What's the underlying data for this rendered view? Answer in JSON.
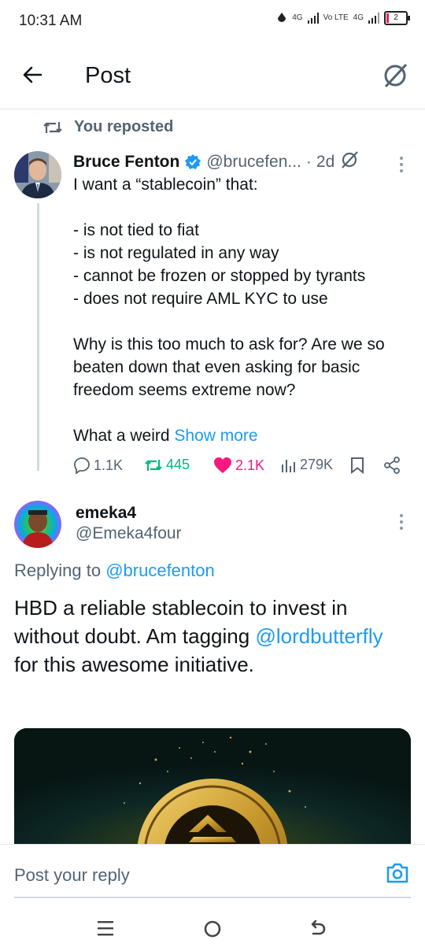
{
  "status_bar": {
    "time": "10:31 AM",
    "signal1": "4G",
    "signal2": "Vo LTE",
    "signal3": "4G",
    "battery": "2"
  },
  "header": {
    "title": "Post"
  },
  "repost_notice": "You reposted",
  "tweet": {
    "author_name": "Bruce Fenton",
    "author_handle": "@brucefen...",
    "time_sep": "·",
    "age": "2d",
    "lines": [
      "I want a “stablecoin” that:",
      "",
      "- is not tied to fiat",
      "- is not regulated in any way",
      "- cannot be frozen or stopped by tyrants",
      "- does not require AML KYC to use",
      "",
      "Why is this too much to ask for?  Are we so beaten down that even asking for basic freedom seems extreme now?",
      "",
      "What a weird"
    ],
    "show_more": "Show more",
    "stats": {
      "replies": "1.1K",
      "reposts": "445",
      "likes": "2.1K",
      "views": "279K"
    }
  },
  "reply": {
    "author_name": "emeka4",
    "author_handle": "@Emeka4four",
    "replying_prefix": "Replying to",
    "replying_to": "@brucefenton",
    "text_before": "HBD a reliable stablecoin to invest in without doubt. Am tagging",
    "mention": "@lordbutterfly",
    "text_after": "for this awesome initiative."
  },
  "composer": {
    "placeholder": "Post your reply"
  },
  "colors": {
    "accent": "#1d9bf0",
    "repost_green": "#00ba7c",
    "like_pink": "#f91880",
    "muted": "#536471"
  }
}
